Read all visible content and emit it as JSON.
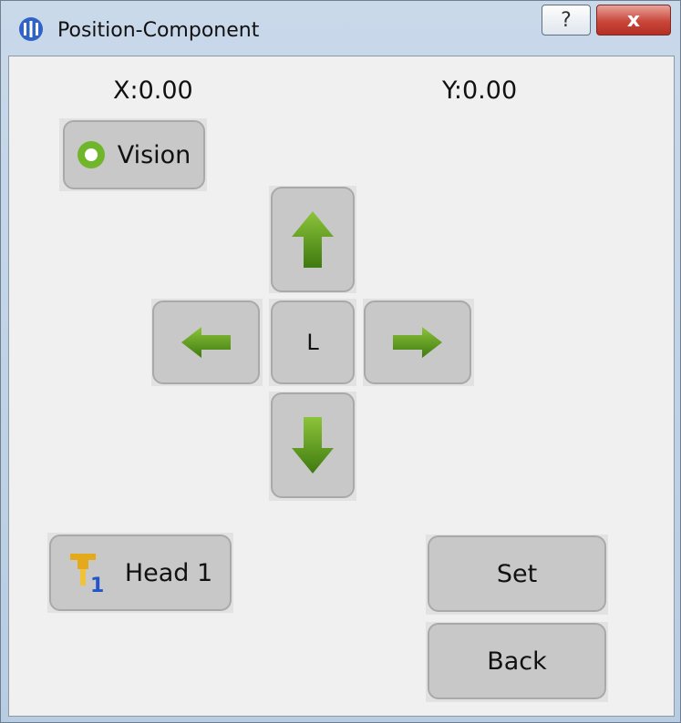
{
  "window": {
    "title": "Position-Component",
    "help_label": "?",
    "close_label": "x"
  },
  "coords": {
    "x": "X:0.00",
    "y": "Y:0.00"
  },
  "buttons": {
    "vision": "Vision",
    "center": "L",
    "head": "Head 1",
    "set": "Set",
    "back": "Back"
  },
  "icons": {
    "vision": "green-ring-icon",
    "up": "arrow-up-icon",
    "down": "arrow-down-icon",
    "left": "arrow-left-icon",
    "right": "arrow-right-icon",
    "head": "nozzle-head-1-icon"
  },
  "colors": {
    "arrow_green": "#5a9a1c",
    "button_gray": "#c8c8c8",
    "client_bg": "#f0f0f0"
  }
}
